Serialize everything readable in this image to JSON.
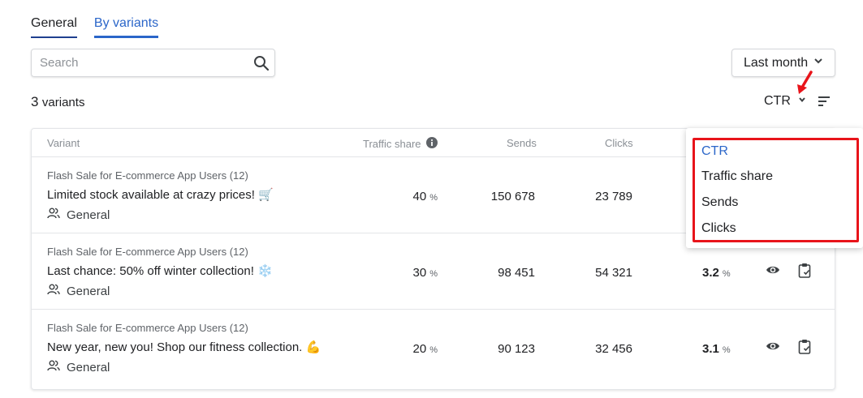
{
  "tabs": [
    {
      "label": "General"
    },
    {
      "label": "By variants"
    }
  ],
  "search": {
    "placeholder": "Search",
    "value": ""
  },
  "period": {
    "label": "Last month"
  },
  "summary": {
    "count": "3",
    "label": "variants"
  },
  "sort": {
    "label": "CTR"
  },
  "table": {
    "headers": {
      "variant": "Variant",
      "traffic": "Traffic share",
      "sends": "Sends",
      "clicks": "Clicks"
    },
    "rows": [
      {
        "segment": "Flash Sale for E-commerce App Users (12)",
        "message": "Limited stock available at crazy prices! 🛒",
        "group": "General",
        "traffic": "40",
        "traffic_unit": "%",
        "sends": "150 678",
        "clicks": "23 789",
        "ctr": "",
        "ctr_unit": ""
      },
      {
        "segment": "Flash Sale for E-commerce App Users (12)",
        "message": "Last chance: 50% off winter collection! ❄️",
        "group": "General",
        "traffic": "30",
        "traffic_unit": "%",
        "sends": "98 451",
        "clicks": "54 321",
        "ctr": "3.2",
        "ctr_unit": "%"
      },
      {
        "segment": "Flash Sale for E-commerce App Users (12)",
        "message": "New year, new you! Shop our fitness collection. 💪",
        "group": "General",
        "traffic": "20",
        "traffic_unit": "%",
        "sends": "90 123",
        "clicks": "32 456",
        "ctr": "3.1",
        "ctr_unit": "%"
      }
    ]
  },
  "sort_menu": {
    "items": [
      {
        "label": "CTR"
      },
      {
        "label": "Traffic share"
      },
      {
        "label": "Sends"
      },
      {
        "label": "Clicks"
      }
    ]
  },
  "colors": {
    "accent": "#2b66c9",
    "highlight": "#e8141a"
  }
}
